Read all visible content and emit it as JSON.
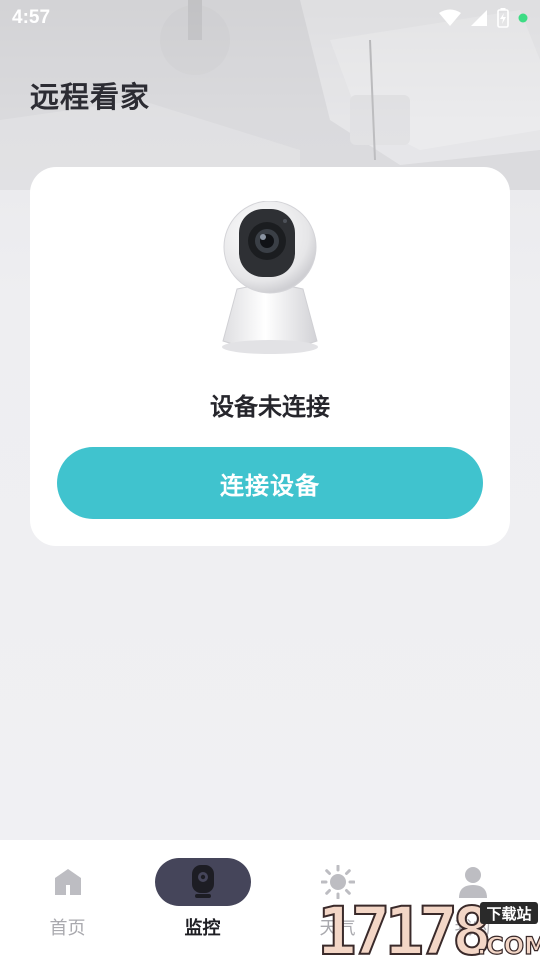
{
  "status_bar": {
    "time": "4:57",
    "icons": [
      "wifi-icon",
      "signal-icon",
      "battery-icon",
      "dot-icon"
    ],
    "dot_color": "#3ddc84"
  },
  "header": {
    "title": "远程看家"
  },
  "device_card": {
    "status_text": "设备未连接",
    "connect_button_label": "连接设备",
    "accent_color": "#40c3ce"
  },
  "tab_bar": {
    "tabs": [
      {
        "label": "首页",
        "icon": "home-icon",
        "active": false
      },
      {
        "label": "监控",
        "icon": "camera-icon",
        "active": true
      },
      {
        "label": "天气",
        "icon": "sun-icon",
        "active": false
      },
      {
        "label": "我的",
        "icon": "user-icon",
        "active": false
      }
    ]
  },
  "watermark": {
    "text": "17178",
    "sub_top": "下载站",
    "sub_bottom": ".COM"
  }
}
